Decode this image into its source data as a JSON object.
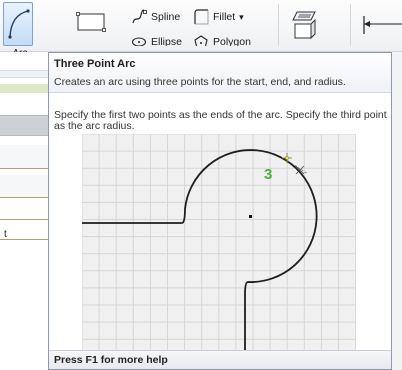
{
  "ribbon": {
    "arc_label": "Arc",
    "arc_dropdown_glyph": "▾",
    "spline_label": "Spline",
    "fillet_label": "Fillet",
    "fillet_dropdown_glyph": "▾",
    "ellipse_label": "Ellipse",
    "polygon_label": "Polygon"
  },
  "left_panel": {
    "item_text": "t"
  },
  "tooltip": {
    "title": "Three Point Arc",
    "description": "Creates an arc using three points for the start, end, and radius.",
    "body": "Specify the first two points as the ends of the arc. Specify the third point as the arc radius.",
    "illustration_step": "3",
    "footer": "Press F1 for more help"
  },
  "colors": {
    "accent": "#7da2ce",
    "grid_line": "#d6d6d6",
    "grid_bg": "#f0f0f0",
    "step_number": "#4caf3a",
    "tooltip_border": "#8e9aab"
  }
}
